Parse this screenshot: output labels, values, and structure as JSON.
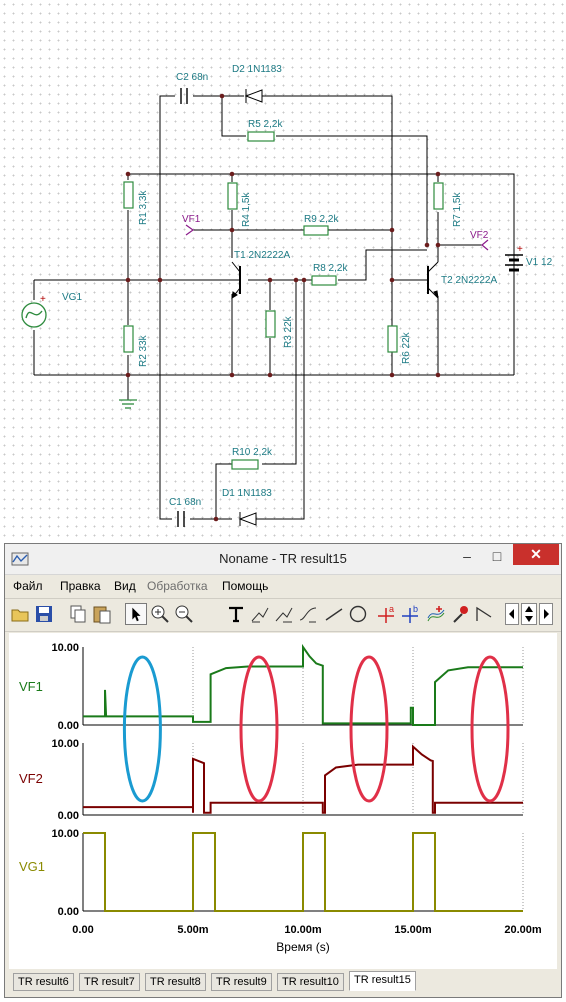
{
  "schematic": {
    "components": {
      "C2": "C2 68n",
      "D2": "D2 1N1183",
      "R5": "R5 2,2k",
      "R1": "R1 3,3k",
      "R4": "R4 1,5k",
      "R7": "R7 1,5k",
      "VF1": "VF1",
      "R9": "R9 2,2k",
      "VF2": "VF2",
      "V1": "V1 12",
      "T1": "T1 2N2222A",
      "R8": "R8 2,2k",
      "T2": "T2 2N2222A",
      "VG1": "VG1",
      "R2": "R2 33k",
      "R3": "R3 22k",
      "R6": "R6 22k",
      "R10": "R10 2,2k",
      "D1": "D1 1N1183",
      "C1": "C1 68n"
    },
    "pin_labels": {
      "plus": "+",
      "minus": "-"
    },
    "colors": {
      "wire": "#000000",
      "resistor": "#2e8b3e",
      "label": "#1c7a84",
      "probe": "#8b1c8b",
      "pin": "#b00000"
    }
  },
  "window": {
    "title": "Noname - TR result15",
    "controls": {
      "minimize": "–",
      "maximize": "□",
      "close": "✕"
    }
  },
  "menu": {
    "items": [
      {
        "label": "Файл",
        "enabled": true
      },
      {
        "label": "Правка",
        "enabled": true
      },
      {
        "label": "Вид",
        "enabled": true
      },
      {
        "label": "Обработка",
        "enabled": false
      },
      {
        "label": "Помощь",
        "enabled": true
      }
    ]
  },
  "toolbar": {
    "tools": [
      "open-folder-icon",
      "save-icon",
      "copy-icon",
      "paste-icon",
      "pointer-icon",
      "zoom-in-icon",
      "zoom-out-icon",
      "text-tool-icon",
      "curve-label-icon",
      "curve-label-alt-icon",
      "formula-icon",
      "line-icon",
      "ellipse-icon",
      "cursor-a-icon",
      "cursor-b-icon",
      "add-curve-icon",
      "color-picker-icon",
      "step-icon",
      "scroll-left-icon",
      "scroll-updown-icon",
      "scroll-right-icon"
    ],
    "cursor_a_label": "a",
    "cursor_b_label": "b"
  },
  "chart_data": {
    "type": "line",
    "xlabel": "Время (s)",
    "xticks": [
      "0.00",
      "5.00m",
      "10.00m",
      "15.00m",
      "20.00m"
    ],
    "xlim": [
      0,
      20
    ],
    "x_unit": "ms",
    "grid": true,
    "panels": [
      {
        "name": "VF1",
        "color": "#1a7a1a",
        "ylim": [
          0,
          10
        ],
        "yticks": [
          "10.00",
          "0.00"
        ],
        "points": [
          [
            0,
            1.1
          ],
          [
            1.0,
            1.1
          ],
          [
            1.0,
            4.5
          ],
          [
            1.05,
            1.1
          ],
          [
            5.0,
            1.1
          ],
          [
            5.0,
            0.4
          ],
          [
            5.8,
            0.4
          ],
          [
            5.8,
            6.5
          ],
          [
            6.5,
            7.3
          ],
          [
            7.5,
            7.5
          ],
          [
            9.8,
            7.5
          ],
          [
            10.0,
            7.5
          ],
          [
            10.0,
            10.0
          ],
          [
            10.3,
            8.8
          ],
          [
            10.6,
            7.9
          ],
          [
            10.9,
            7.6
          ],
          [
            10.9,
            0.2
          ],
          [
            14.9,
            0.2
          ],
          [
            14.9,
            2.2
          ],
          [
            15.0,
            2.2
          ],
          [
            15.0,
            0.0
          ],
          [
            16.0,
            0.0
          ],
          [
            16.0,
            5.5
          ],
          [
            16.6,
            7.0
          ],
          [
            17.5,
            7.4
          ],
          [
            20,
            7.4
          ]
        ]
      },
      {
        "name": "VF2",
        "color": "#7a0000",
        "ylim": [
          0,
          10
        ],
        "yticks": [
          "10.00",
          "0.00"
        ],
        "points": [
          [
            0,
            1.1
          ],
          [
            5.0,
            1.1
          ],
          [
            5.0,
            0.3
          ],
          [
            5.0,
            7.8
          ],
          [
            5.5,
            7.2
          ],
          [
            5.5,
            0.3
          ],
          [
            5.8,
            0.3
          ],
          [
            5.8,
            1.7
          ],
          [
            10.9,
            1.7
          ],
          [
            10.9,
            0.3
          ],
          [
            11.0,
            0.3
          ],
          [
            11.0,
            5.5
          ],
          [
            11.5,
            6.6
          ],
          [
            12.5,
            7.0
          ],
          [
            15.0,
            7.0
          ],
          [
            15.0,
            9.5
          ],
          [
            15.4,
            8.4
          ],
          [
            15.8,
            7.6
          ],
          [
            15.9,
            7.5
          ],
          [
            15.9,
            0.3
          ],
          [
            16.0,
            0.3
          ],
          [
            16.0,
            1.7
          ],
          [
            20,
            1.7
          ]
        ]
      },
      {
        "name": "VG1",
        "color": "#8a8a00",
        "ylim": [
          0,
          10
        ],
        "yticks": [
          "10.00",
          "0.00"
        ],
        "points": [
          [
            0,
            10
          ],
          [
            1.0,
            10
          ],
          [
            1.0,
            0
          ],
          [
            5.0,
            0
          ],
          [
            5.0,
            10
          ],
          [
            6.0,
            10
          ],
          [
            6.0,
            0
          ],
          [
            10.0,
            0
          ],
          [
            10.0,
            10
          ],
          [
            11.0,
            10
          ],
          [
            11.0,
            0
          ],
          [
            15.0,
            0
          ],
          [
            15.0,
            10
          ],
          [
            16.0,
            10
          ],
          [
            16.0,
            0
          ],
          [
            20,
            0
          ]
        ]
      }
    ],
    "annotations": [
      {
        "shape": "ellipse",
        "color": "#1a9bd1",
        "x": 2.7,
        "y_panel": "VF1-VF2"
      },
      {
        "shape": "ellipse",
        "color": "#e03048",
        "x": 8.0,
        "y_panel": "VF1-VF2"
      },
      {
        "shape": "ellipse",
        "color": "#e03048",
        "x": 13.0,
        "y_panel": "VF1-VF2"
      },
      {
        "shape": "ellipse",
        "color": "#e03048",
        "x": 18.5,
        "y_panel": "VF1-VF2"
      }
    ]
  },
  "tabs": {
    "items": [
      "TR result6",
      "TR result7",
      "TR result8",
      "TR result9",
      "TR result10",
      "TR result15"
    ],
    "active": "TR result15"
  }
}
